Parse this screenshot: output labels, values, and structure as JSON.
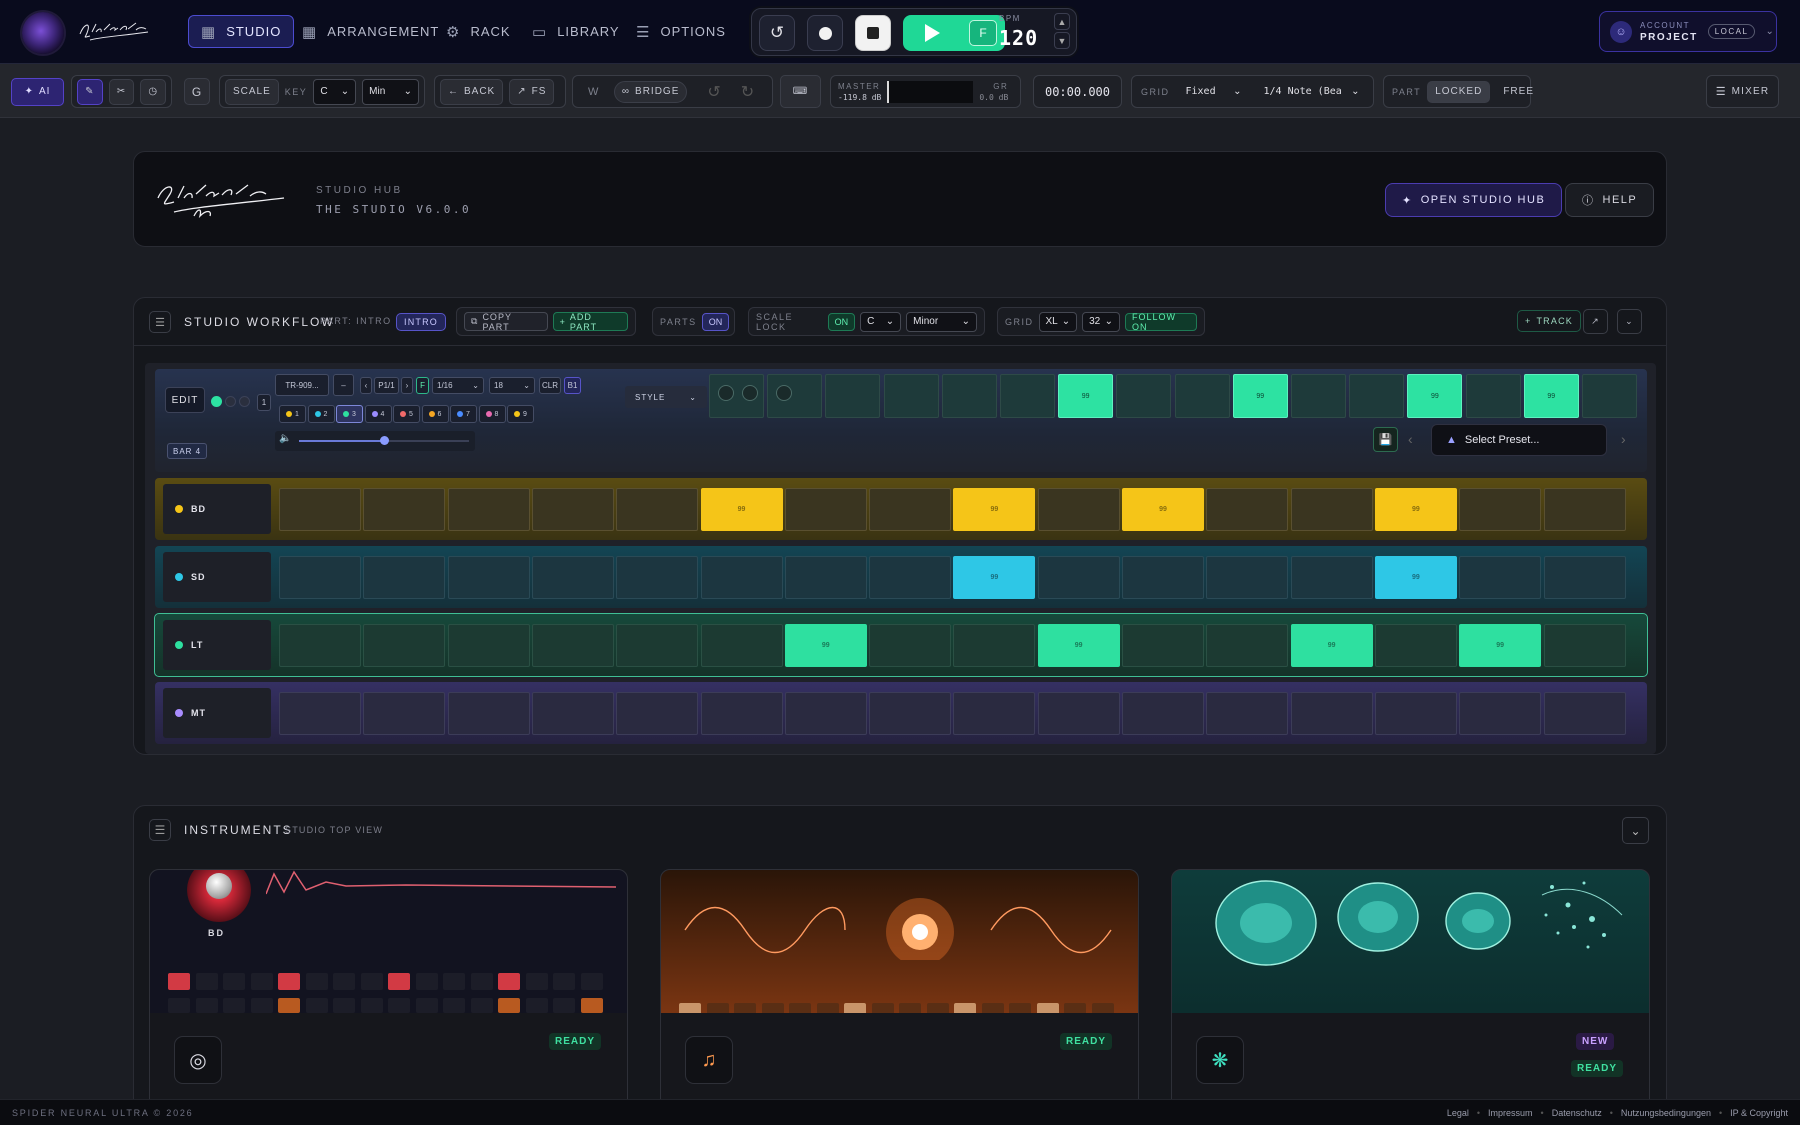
{
  "nav": {
    "items": [
      {
        "label": "STUDIO",
        "icon": "grid-icon"
      },
      {
        "label": "ARRANGEMENT",
        "icon": "table-icon"
      },
      {
        "label": "RACK",
        "icon": "gear-icon"
      },
      {
        "label": "LIBRARY",
        "icon": "drive-icon"
      },
      {
        "label": "OPTIONS",
        "icon": "sliders-icon"
      }
    ],
    "bpm_label": "BPM",
    "bpm_value": "120",
    "play_f": "F",
    "account_label": "ACCOUNT",
    "project_label": "PROJECT",
    "local_badge": "LOCAL"
  },
  "toolbar": {
    "ai_label": "AI",
    "g_label": "G",
    "scale_label": "SCALE",
    "key_label": "KEY",
    "key_value": "C",
    "mode_value": "Min",
    "back_label": "BACK",
    "fs_label": "FS",
    "w_label": "W",
    "bridge_label": "BRIDGE",
    "master_label": "MASTER",
    "master_value": "-119.8 dB",
    "gr_label": "GR",
    "gr_value": "0.0 dB",
    "time_value": "00:00.000",
    "grid_label": "GRID",
    "grid_value": "Fixed",
    "note_value": "1/4 Note (Bea",
    "part_label": "PART",
    "locked_label": "LOCKED",
    "free_label": "FREE",
    "mixer_label": "MIXER"
  },
  "hub": {
    "subtitle": "STUDIO HUB",
    "version": "THE STUDIO V6.0.0",
    "open_label": "OPEN STUDIO HUB",
    "help_label": "HELP"
  },
  "workflow": {
    "title": "STUDIO WORKFLOW",
    "part_label": "PART: INTRO",
    "intro_badge": "INTRO",
    "copy_part": "COPY PART",
    "add_part": "ADD PART",
    "parts_label": "PARTS",
    "parts_on": "ON",
    "scale_lock_label": "SCALE LOCK",
    "scale_lock_on": "ON",
    "scale_key": "C",
    "scale_mode": "Minor",
    "grid_label": "GRID",
    "grid_size": "XL",
    "grid_steps": "32",
    "follow_label": "FOLLOW ON",
    "track_label": "TRACK"
  },
  "seq": {
    "edit_label": "EDIT",
    "one_label": "1",
    "machine": "TR-909...",
    "minus_label": "–",
    "page_label": "P1/1",
    "f_label": "F",
    "div_value": "1/16",
    "steps_value": "18",
    "clr_label": "CLR",
    "b1_label": "B1",
    "style_label": "STYLE",
    "bar_label": "BAR 4",
    "preset_placeholder": "Select Preset...",
    "volume": 0.5,
    "patterns": [
      {
        "label": "1",
        "color": "#f5c518"
      },
      {
        "label": "2",
        "color": "#2ec7e6"
      },
      {
        "label": "3",
        "color": "#2ee0a0"
      },
      {
        "label": "4",
        "color": "#9a8cff"
      },
      {
        "label": "5",
        "color": "#f06a6a"
      },
      {
        "label": "6",
        "color": "#f5a623"
      },
      {
        "label": "7",
        "color": "#4a8cff"
      },
      {
        "label": "8",
        "color": "#e86ab0"
      },
      {
        "label": "9",
        "color": "#f5c518"
      }
    ],
    "top_steps": [
      0,
      0,
      0,
      0,
      0,
      0,
      1,
      0,
      0,
      1,
      0,
      0,
      1,
      0,
      1,
      0
    ],
    "step_value": "99",
    "tracks": [
      {
        "name": "BD",
        "color": "#f5c518",
        "steps": [
          0,
          0,
          0,
          0,
          0,
          1,
          0,
          0,
          1,
          0,
          1,
          0,
          0,
          1,
          0,
          0
        ]
      },
      {
        "name": "SD",
        "color": "#2ec7e6",
        "steps": [
          0,
          0,
          0,
          0,
          0,
          0,
          0,
          0,
          1,
          0,
          0,
          0,
          0,
          1,
          0,
          0
        ]
      },
      {
        "name": "LT",
        "color": "#2ee0a0",
        "steps": [
          0,
          0,
          0,
          0,
          0,
          0,
          1,
          0,
          0,
          1,
          0,
          0,
          1,
          0,
          1,
          0
        ]
      },
      {
        "name": "MT",
        "color": "#a98cff",
        "steps": [
          0,
          0,
          0,
          0,
          0,
          0,
          0,
          0,
          0,
          0,
          0,
          0,
          0,
          0,
          0,
          0
        ]
      }
    ]
  },
  "instruments": {
    "title": "INSTRUMENTS",
    "subtitle": "STUDIO TOP VIEW",
    "cards": [
      {
        "knob_label": "BD",
        "badge": "READY"
      },
      {
        "badge": "READY"
      },
      {
        "badge_new": "NEW",
        "badge": "READY"
      }
    ]
  },
  "footer": {
    "copyright": "SPIDER NEURAL ULTRA © 2026",
    "links": [
      "Legal",
      "Impressum",
      "Datenschutz",
      "Nutzungsbedingungen",
      "IP & Copyright"
    ]
  }
}
